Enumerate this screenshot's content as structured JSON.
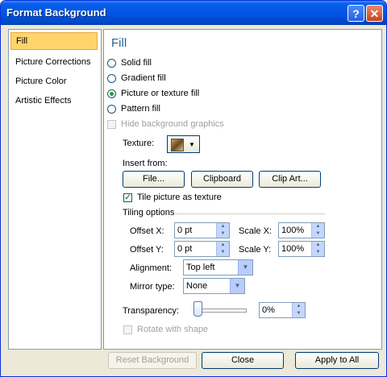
{
  "window": {
    "title": "Format Background"
  },
  "sidebar": {
    "items": [
      {
        "label": "Fill",
        "selected": true
      },
      {
        "label": "Picture Corrections"
      },
      {
        "label": "Picture Color"
      },
      {
        "label": "Artistic Effects"
      }
    ]
  },
  "panel": {
    "heading": "Fill",
    "fill_options": [
      "Solid fill",
      "Gradient fill",
      "Picture or texture fill",
      "Pattern fill"
    ],
    "selected_fill": "Picture or texture fill",
    "hide_background_graphics": "Hide background graphics",
    "texture_label": "Texture:",
    "insert_from_label": "Insert from:",
    "file_button": "File...",
    "clipboard_button": "Clipboard",
    "clipart_button": "Clip Art...",
    "tile_checkbox": "Tile picture as texture",
    "tile_checked": true,
    "tiling_options_label": "Tiling options",
    "offset_x_label": "Offset X:",
    "offset_x_value": "0 pt",
    "offset_y_label": "Offset Y:",
    "offset_y_value": "0 pt",
    "scale_x_label": "Scale X:",
    "scale_x_value": "100%",
    "scale_y_label": "Scale Y:",
    "scale_y_value": "100%",
    "alignment_label": "Alignment:",
    "alignment_value": "Top left",
    "mirror_label": "Mirror type:",
    "mirror_value": "None",
    "transparency_label": "Transparency:",
    "transparency_value": "0%",
    "rotate_label": "Rotate with shape"
  },
  "footer": {
    "reset_button": "Reset Background",
    "close_button": "Close",
    "apply_all_button": "Apply to All"
  },
  "colors": {
    "titlebar": "#0055e5",
    "selected_item": "#ffd46b",
    "heading": "#2a6099"
  }
}
